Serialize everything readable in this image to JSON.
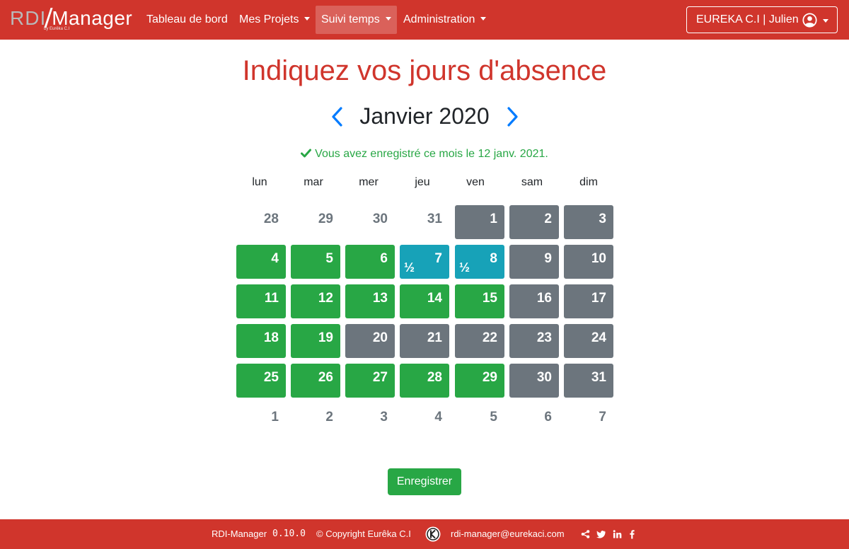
{
  "brand": {
    "name_part1": "RDI",
    "name_part2": "Manager",
    "subtitle": "by Eurêka C.I"
  },
  "nav": {
    "items": [
      {
        "label": "Tableau de bord"
      },
      {
        "label": "Mes Projets"
      },
      {
        "label": "Suivi temps"
      },
      {
        "label": "Administration"
      }
    ],
    "user": {
      "label": "EUREKA C.I | Julien"
    }
  },
  "page": {
    "title": "Indiquez vos jours d'absence",
    "month": "Janvier 2020",
    "saved_message": "Vous avez enregistré ce mois le 12 janv. 2021."
  },
  "calendar": {
    "weekdays": [
      "lun",
      "mar",
      "mer",
      "jeu",
      "ven",
      "sam",
      "dim"
    ],
    "weeks": [
      [
        {
          "d": "28",
          "s": "outside"
        },
        {
          "d": "29",
          "s": "outside"
        },
        {
          "d": "30",
          "s": "outside"
        },
        {
          "d": "31",
          "s": "outside"
        },
        {
          "d": "1",
          "s": "grey"
        },
        {
          "d": "2",
          "s": "grey"
        },
        {
          "d": "3",
          "s": "grey"
        }
      ],
      [
        {
          "d": "4",
          "s": "green"
        },
        {
          "d": "5",
          "s": "green"
        },
        {
          "d": "6",
          "s": "green"
        },
        {
          "d": "7",
          "s": "blue",
          "half": "½"
        },
        {
          "d": "8",
          "s": "blue",
          "half": "½"
        },
        {
          "d": "9",
          "s": "grey"
        },
        {
          "d": "10",
          "s": "grey"
        }
      ],
      [
        {
          "d": "11",
          "s": "green"
        },
        {
          "d": "12",
          "s": "green"
        },
        {
          "d": "13",
          "s": "green"
        },
        {
          "d": "14",
          "s": "green"
        },
        {
          "d": "15",
          "s": "green"
        },
        {
          "d": "16",
          "s": "grey"
        },
        {
          "d": "17",
          "s": "grey"
        }
      ],
      [
        {
          "d": "18",
          "s": "green"
        },
        {
          "d": "19",
          "s": "green"
        },
        {
          "d": "20",
          "s": "grey"
        },
        {
          "d": "21",
          "s": "grey"
        },
        {
          "d": "22",
          "s": "grey"
        },
        {
          "d": "23",
          "s": "grey"
        },
        {
          "d": "24",
          "s": "grey"
        }
      ],
      [
        {
          "d": "25",
          "s": "green"
        },
        {
          "d": "26",
          "s": "green"
        },
        {
          "d": "27",
          "s": "green"
        },
        {
          "d": "28",
          "s": "green"
        },
        {
          "d": "29",
          "s": "green"
        },
        {
          "d": "30",
          "s": "grey"
        },
        {
          "d": "31",
          "s": "grey"
        }
      ],
      [
        {
          "d": "1",
          "s": "outside"
        },
        {
          "d": "2",
          "s": "outside"
        },
        {
          "d": "3",
          "s": "outside"
        },
        {
          "d": "4",
          "s": "outside"
        },
        {
          "d": "5",
          "s": "outside"
        },
        {
          "d": "6",
          "s": "outside"
        },
        {
          "d": "7",
          "s": "outside"
        }
      ]
    ]
  },
  "actions": {
    "save_label": "Enregistrer"
  },
  "footer": {
    "app_name": "RDI-Manager",
    "version": "0.10.0",
    "copyright": "© Copyright Eurêka C.I",
    "email": "rdi-manager@eurekaci.com",
    "social": [
      "share-icon",
      "twitter-icon",
      "linkedin-icon",
      "facebook-icon"
    ]
  },
  "colors": {
    "brand_red": "#d0352c",
    "worked_green": "#28a745",
    "off_grey": "#6c757d",
    "half_blue": "#17a2b8",
    "link_blue": "#007bff"
  },
  "icons": {
    "prev": "chevron-left-icon",
    "next": "chevron-right-icon",
    "saved": "check-icon",
    "user": "user-circle-icon"
  }
}
